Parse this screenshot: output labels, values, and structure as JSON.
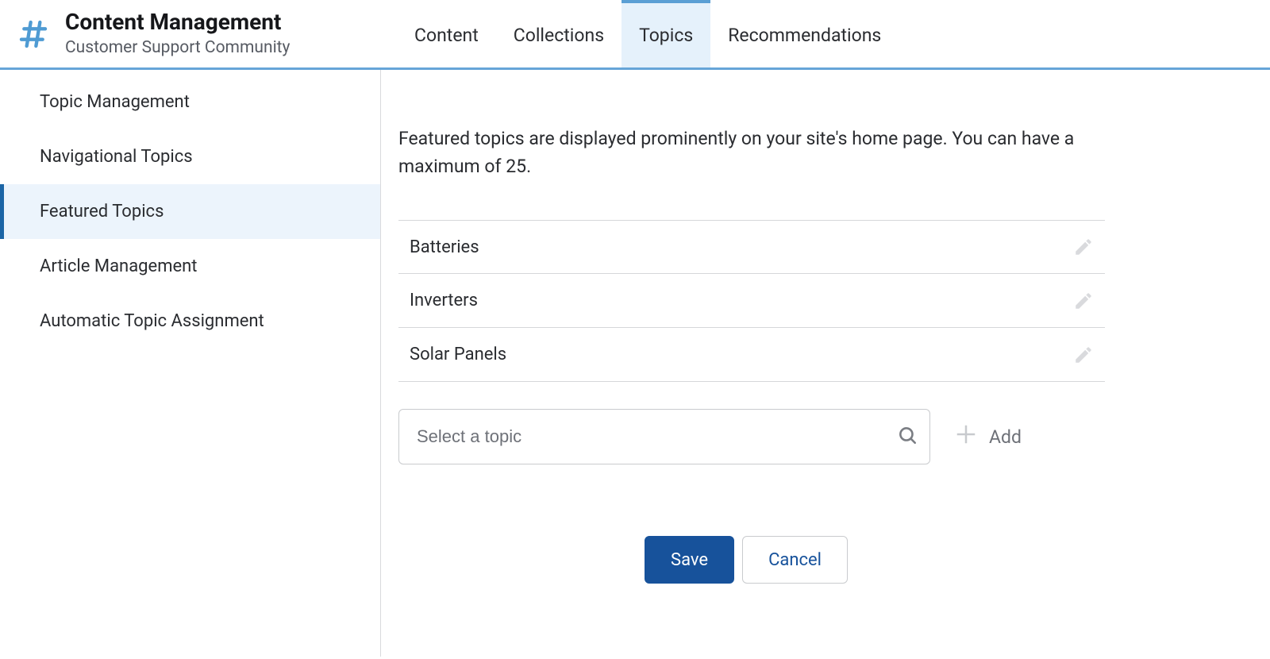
{
  "header": {
    "title": "Content Management",
    "subtitle": "Customer Support Community",
    "tabs": [
      {
        "label": "Content",
        "active": false
      },
      {
        "label": "Collections",
        "active": false
      },
      {
        "label": "Topics",
        "active": true
      },
      {
        "label": "Recommendations",
        "active": false
      }
    ]
  },
  "sidebar": {
    "items": [
      {
        "label": "Topic Management",
        "active": false
      },
      {
        "label": "Navigational Topics",
        "active": false
      },
      {
        "label": "Featured Topics",
        "active": true
      },
      {
        "label": "Article Management",
        "active": false
      },
      {
        "label": "Automatic Topic Assignment",
        "active": false
      }
    ]
  },
  "main": {
    "description": "Featured topics are displayed prominently on your site's home page. You can have a maximum of 25.",
    "topics": [
      {
        "name": "Batteries"
      },
      {
        "name": "Inverters"
      },
      {
        "name": "Solar Panels"
      }
    ],
    "select_placeholder": "Select a topic",
    "add_label": "Add",
    "save_label": "Save",
    "cancel_label": "Cancel"
  }
}
